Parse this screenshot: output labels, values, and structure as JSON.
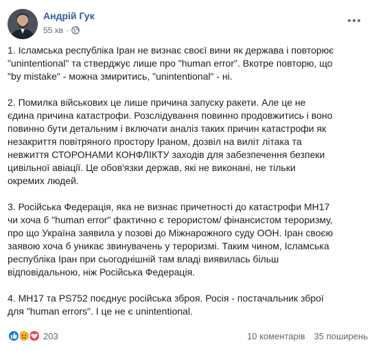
{
  "post": {
    "author": "Андрій Гук",
    "time": "55 хв",
    "separator": "·",
    "paragraphs": [
      {
        "lines": [
          "1. Ісламська республіка Іран не визнає своєї вини як держава і повторює",
          "\"unintentional\" та стверджує лише про \"human error\". Вкотре повторю, що",
          "\"by mistake\" - можна змиритись, \"unintentional\" - ні."
        ]
      },
      {
        "lines": [
          "2. Помилка військових це лише причина запуску ракети. Але це не",
          "єдина причина катастрофи. Розслідування повинно продовжитись і воно",
          "повинно бути детальним і включати аналіз таких причин катастрофи як",
          "незакриття повітряного простору Іраном, дозвіл на виліт літака та",
          "невжиття СТОРОНАМИ КОНФЛІКТУ заходів для забезпечення безпеки",
          "цивільної авіації. Це обов'язки держав, які не виконані, не тільки",
          "окремих людей."
        ]
      },
      {
        "lines": [
          "3. Російська Федерація, яка не визнає причетності до катастрофи МН17",
          "чи хоча б \"human error\" фактично є терористом/ фінансистом тероризму,",
          "про що Україна заявила у позові до Міжнарожного суду ООН. Іран своєю",
          "заявою хоча б уникає звинувачень у тероризмі. Таким чином, Ісламська",
          "республіка Іран при сьогоднішній там владі виявилась більш",
          "відповідальною, ніж Російська Федерація."
        ]
      },
      {
        "lines": [
          "4. МН17 та PS752 поєднує російська зброя. Росія - постачальник зброї",
          "для \"human errors\". І це не є unintentional."
        ]
      }
    ],
    "reactions": {
      "icons": [
        "like-icon",
        "sad-icon",
        "love-icon"
      ],
      "count": "203"
    },
    "comments": "10 коментарів",
    "shares": "35 поширень"
  },
  "colors": {
    "author": "#385898",
    "meta": "#616770",
    "text": "#1c1e21",
    "like": "#1877f2",
    "sad": "#f7b125",
    "love": "#f33e58"
  }
}
